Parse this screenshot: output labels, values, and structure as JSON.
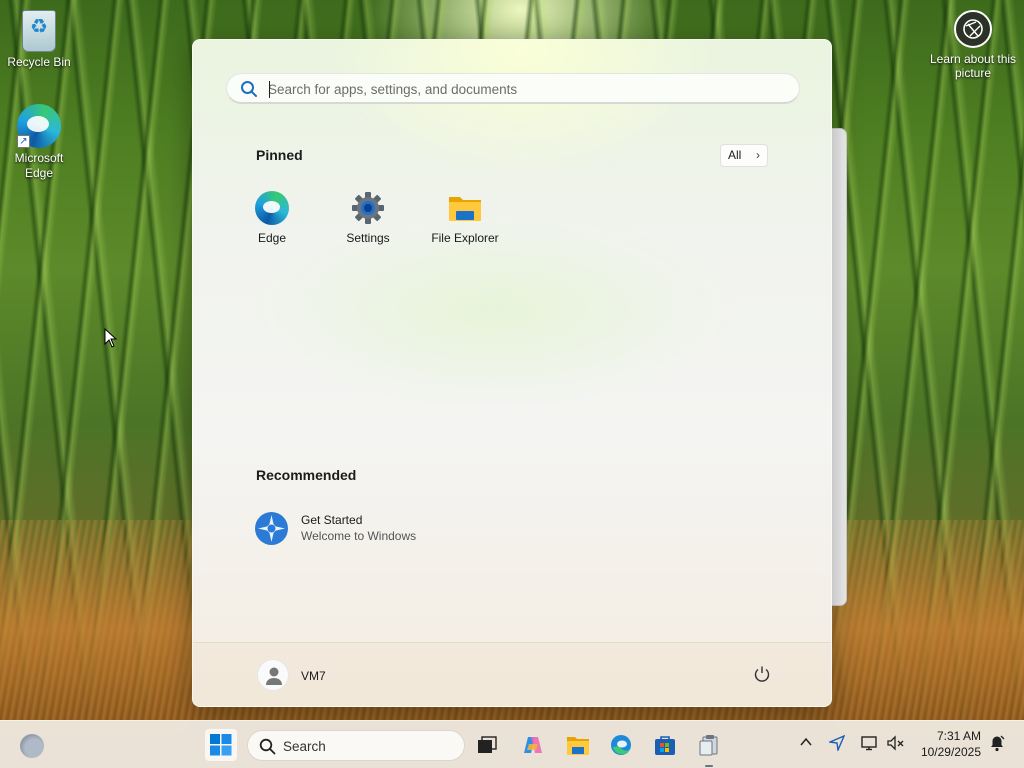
{
  "desktop": {
    "icons": [
      {
        "label": "Recycle Bin",
        "icon": "recycle-bin-icon"
      },
      {
        "label": "Microsoft Edge",
        "icon": "edge-icon"
      }
    ],
    "learn_label": "Learn about this picture"
  },
  "start_menu": {
    "search_placeholder": "Search for apps, settings, and documents",
    "pinned_title": "Pinned",
    "all_button": "All",
    "pinned": [
      {
        "label": "Edge",
        "icon": "edge-icon"
      },
      {
        "label": "Settings",
        "icon": "settings-gear-icon"
      },
      {
        "label": "File Explorer",
        "icon": "folder-icon"
      }
    ],
    "recommended_title": "Recommended",
    "recommended": [
      {
        "title": "Get Started",
        "subtitle": "Welcome to Windows",
        "icon": "get-started-icon"
      }
    ],
    "user_name": "VM7"
  },
  "taskbar": {
    "search_label": "Search",
    "time": "7:31 AM",
    "date": "10/29/2025",
    "accent": "#0078d4"
  }
}
